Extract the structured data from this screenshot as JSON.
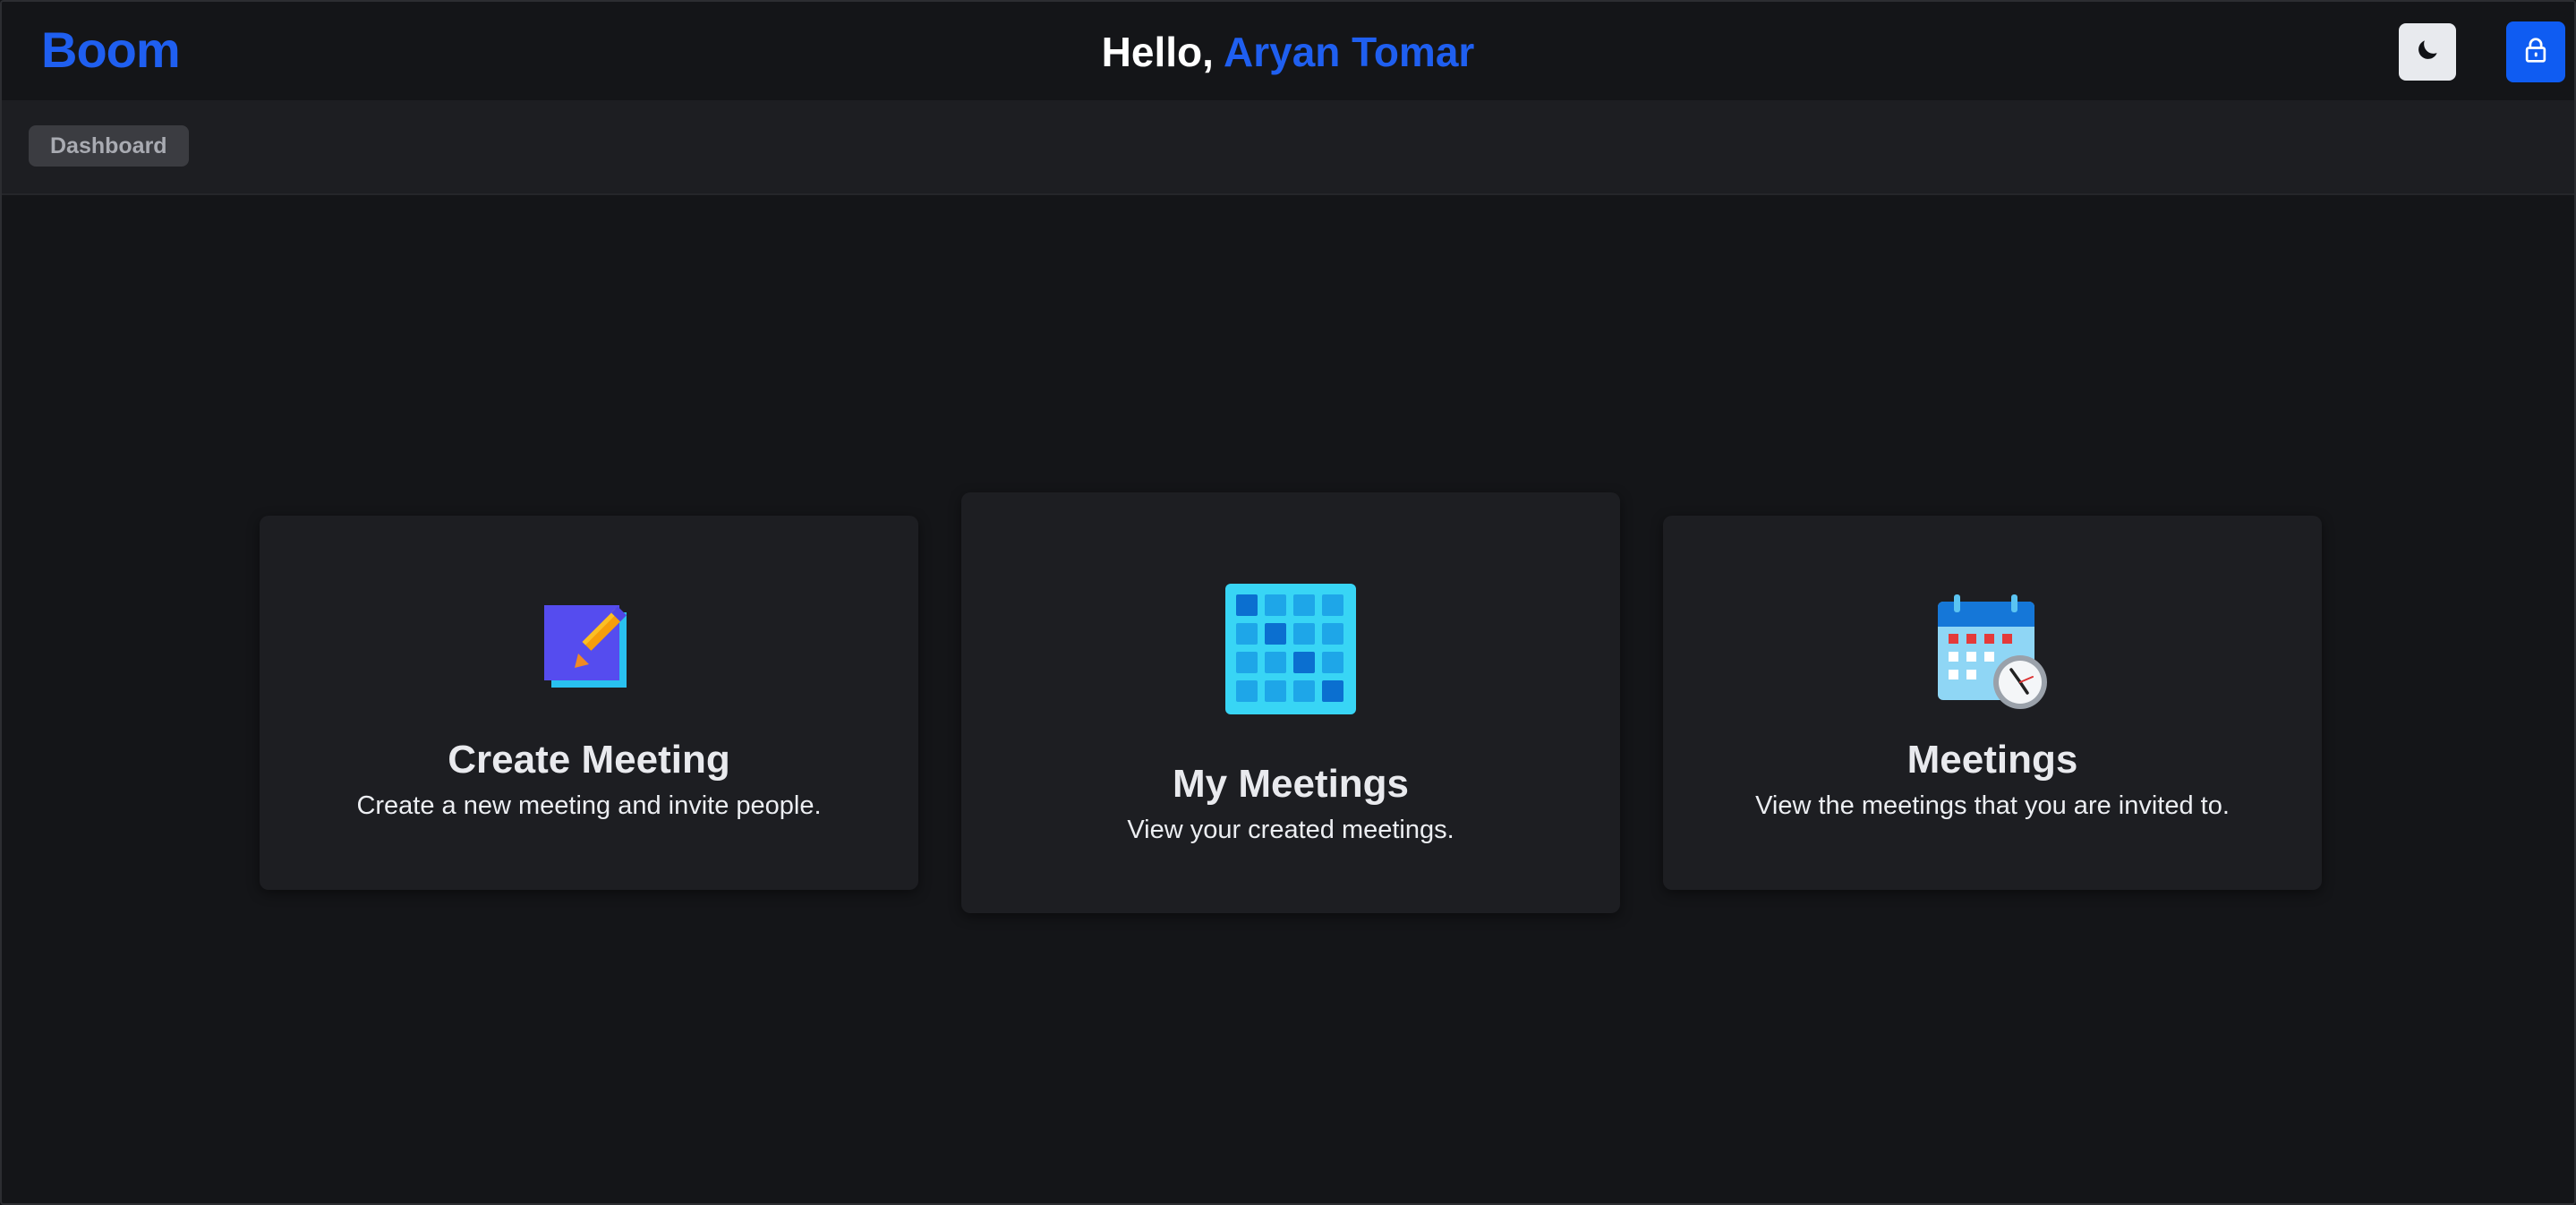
{
  "app": {
    "logo_text": "Boom",
    "greeting_prefix": "Hello,",
    "user_name": "Aryan Tomar"
  },
  "header": {
    "theme_toggle_icon": "moon-icon",
    "lock_button_icon": "lock-icon"
  },
  "breadcrumb": {
    "items": [
      "Dashboard"
    ]
  },
  "cards": [
    {
      "icon": "create-meeting-icon",
      "title": "Create Meeting",
      "description": "Create a new meeting and invite people."
    },
    {
      "icon": "my-meetings-grid-icon",
      "title": "My Meetings",
      "description": "View your created meetings."
    },
    {
      "icon": "calendar-clock-icon",
      "title": "Meetings",
      "description": "View the meetings that you are invited to."
    }
  ],
  "colors": {
    "accent": "#0f5cf2",
    "background": "#141518",
    "card": "#1d1e22"
  }
}
